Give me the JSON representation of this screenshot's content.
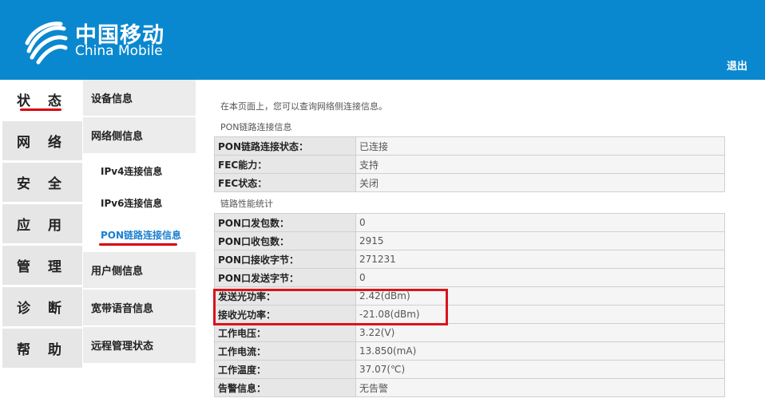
{
  "header": {
    "brand_cn": "中国移动",
    "brand_en": "China Mobile",
    "logout_label": "退出",
    "bg_color": "#0a88cf"
  },
  "mainnav": {
    "items": [
      {
        "label": "状 态"
      },
      {
        "label": "网 络"
      },
      {
        "label": "安 全"
      },
      {
        "label": "应 用"
      },
      {
        "label": "管 理"
      },
      {
        "label": "诊 断"
      },
      {
        "label": "帮 助"
      }
    ]
  },
  "subnav": {
    "device_info": "设备信息",
    "network_info": "网络侧信息",
    "children": [
      {
        "label": "IPv4连接信息"
      },
      {
        "label": "IPv6连接信息"
      },
      {
        "label": "PON链路连接信息"
      }
    ],
    "user_info": "用户侧信息",
    "broadband_voice": "宽带语音信息",
    "remote_mgmt": "远程管理状态"
  },
  "content": {
    "intro": "在本页面上，您可以查询网络侧连接信息。",
    "section1_title": "PON链路连接信息",
    "section1_rows": [
      {
        "key": "PON链路连接状态：",
        "value": "已连接"
      },
      {
        "key": "FEC能力：",
        "value": "支持"
      },
      {
        "key": "FEC状态：",
        "value": "关闭"
      }
    ],
    "section2_title": "链路性能统计",
    "section2_rows": [
      {
        "key": "PON口发包数：",
        "value": "0"
      },
      {
        "key": "PON口收包数：",
        "value": "2915"
      },
      {
        "key": "PON口接收字节：",
        "value": "271231"
      },
      {
        "key": "PON口发送字节：",
        "value": "0"
      },
      {
        "key": "发送光功率：",
        "value": "2.42(dBm)"
      },
      {
        "key": "接收光功率：",
        "value": "-21.08(dBm)"
      },
      {
        "key": "工作电压：",
        "value": "3.22(V)"
      },
      {
        "key": "工作电流：",
        "value": "13.850(mA)"
      },
      {
        "key": "工作温度：",
        "value": "37.07(℃)"
      },
      {
        "key": "告警信息：",
        "value": "无告警"
      }
    ]
  }
}
